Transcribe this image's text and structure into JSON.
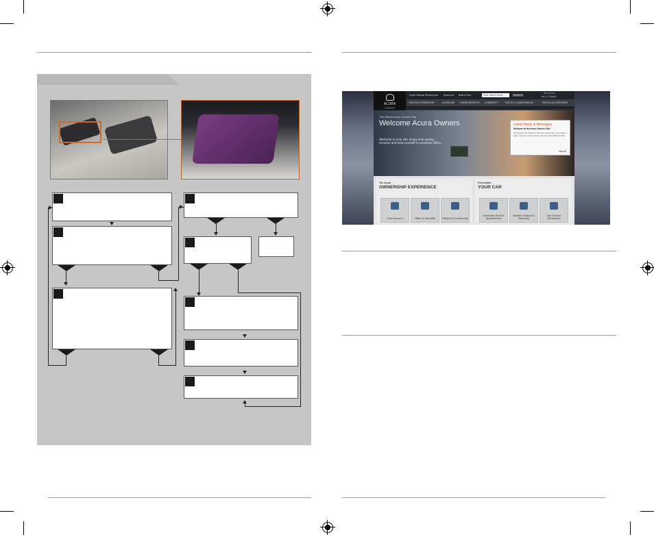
{
  "website": {
    "logo": "ACURA",
    "logo_sub": "OWNERS",
    "topbar_links": [
      "Acura Financial Services.com",
      "Acura.com",
      "Build & Price"
    ],
    "search_placeholder": "Enter Search Terms",
    "search_button": "SEARCH",
    "account_links": [
      "My Account",
      "Log In | Register"
    ],
    "nav_items": [
      "VEHICLE INFORMATION",
      "ACURALINK",
      "OWNER BENEFITS",
      "COMMUNITY",
      "SERVICE & MAINTENANCE",
      "PARTS & ACCESSORIES"
    ],
    "hero_kicker": "The Official Acura Owners Site",
    "hero_title": "Welcome Acura Owners",
    "hero_text": "Welcome to your site. Enjoy time saving services and treat yourself to exclusive offers.",
    "news_title": "Latest News & Messages",
    "news_subtitle": "Welcome to the Acura Owners Site!",
    "news_body": "We discuss the details of this site's new look. If you have a login, sign in to your account. All your information is here.",
    "news_more": "View All",
    "section1_kicker": "The Acura",
    "section1_title": "OWNERSHIP EXPERIENCE",
    "section1_tiles": [
      "Your Account",
      "Offers & Benefits",
      "Stories & Community"
    ],
    "section2_kicker": "Personalize",
    "section2_title": "YOUR CAR",
    "section2_tiles": [
      "Schedule Service Appointment",
      "Owner's Manual & Warranty",
      "Get Service Reminders"
    ]
  }
}
